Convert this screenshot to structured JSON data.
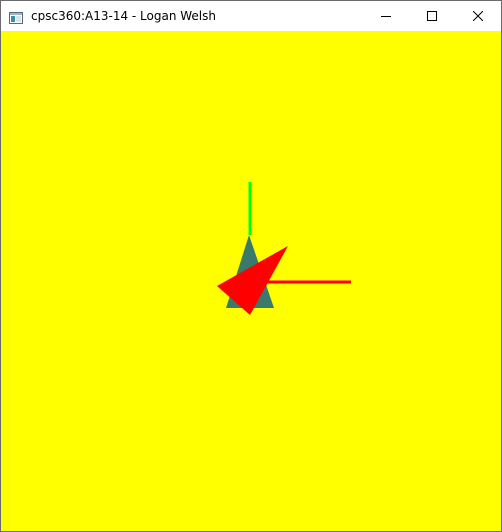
{
  "window": {
    "title": "cpsc360:A13-14 - Logan Welsh",
    "icon": "app-window-icon",
    "controls": {
      "minimize_icon": "minimize-icon",
      "maximize_icon": "maximize-icon",
      "close_icon": "close-icon"
    }
  },
  "scene": {
    "background_color": "#ffff00",
    "x_axis_color": "#ff0000",
    "y_axis_color": "#00ff00",
    "model_color": "#3a7a6a",
    "arrow_color": "#ff0000"
  }
}
